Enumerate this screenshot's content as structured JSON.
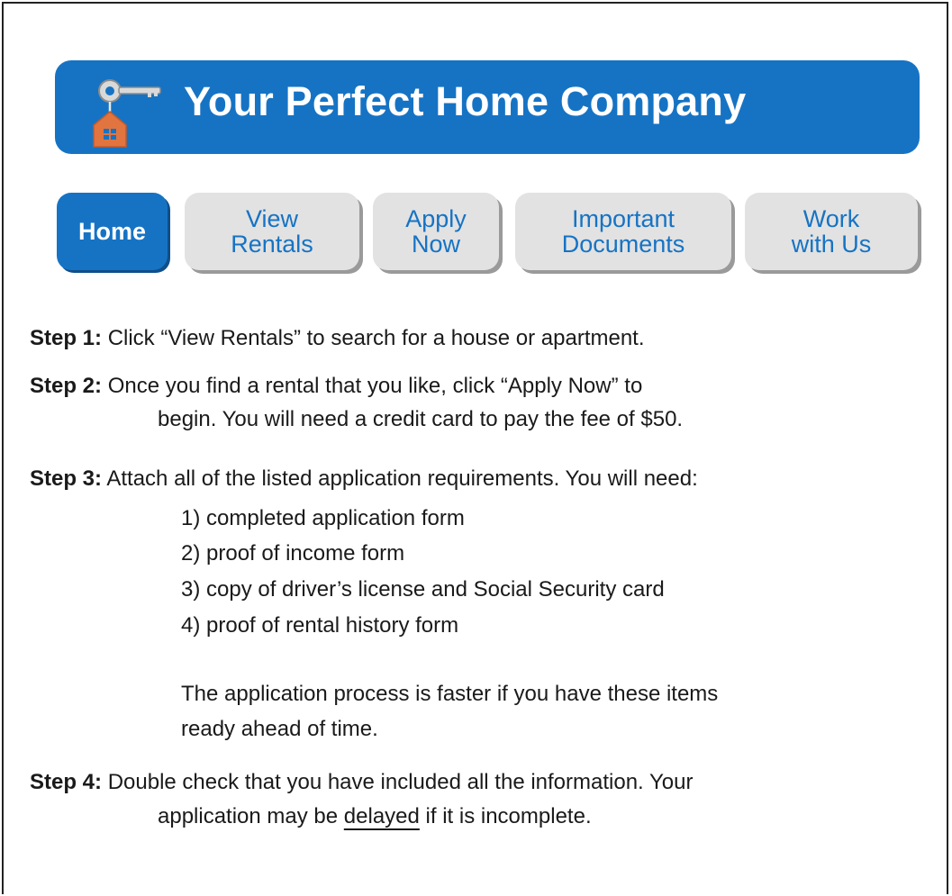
{
  "banner": {
    "title": "Your Perfect Home Company",
    "logo_icon": "house-key-icon",
    "background_color": "#1673c4"
  },
  "nav": {
    "items": [
      {
        "label": "Home",
        "active": true
      },
      {
        "label": "View\nRentals",
        "active": false
      },
      {
        "label": "Apply\nNow",
        "active": false
      },
      {
        "label": "Important\nDocuments",
        "active": false
      },
      {
        "label": "Work\nwith Us",
        "active": false
      }
    ]
  },
  "steps": [
    {
      "label": "Step 1:",
      "lines": [
        "Click “View Rentals” to search for a house or apartment."
      ]
    },
    {
      "label": "Step 2:",
      "lines": [
        "Once you find a rental that you like, click “Apply Now” to",
        "begin. You will need a credit card to pay the fee of $50."
      ]
    },
    {
      "label": "Step 3:",
      "lines": [
        "Attach all of the listed application requirements. You will need:"
      ],
      "requirements": [
        "1) completed application form",
        "2) proof of income form",
        "3) copy of driver’s license and Social Security card",
        "4) proof of rental history form"
      ],
      "note_lines": [
        "The application process is faster if you have these items",
        "ready ahead of time."
      ]
    },
    {
      "label": "Step 4:",
      "lines": [
        "Double check that you have included all the information. Your"
      ],
      "line2_before": "application may be ",
      "line2_underlined": "delayed",
      "line2_after": " if it is incomplete."
    }
  ]
}
